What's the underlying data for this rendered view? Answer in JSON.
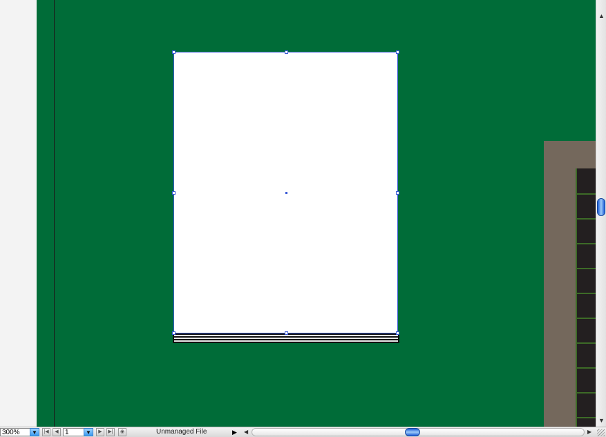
{
  "document": {
    "zoom": "300%",
    "page_number": "1",
    "status": "Unmanaged File"
  },
  "icons": {
    "zoom_dropdown": "chevron-down-icon",
    "first_page": "first-page-icon",
    "prev_page": "prev-page-icon",
    "page_dropdown": "chevron-down-icon",
    "next_page": "next-page-icon",
    "last_page": "last-page-icon",
    "preflight": "preflight-icon",
    "status_menu": "triangle-right-icon",
    "scroll_left": "arrow-left-icon",
    "scroll_right": "arrow-right-icon",
    "scroll_up": "arrow-up-icon",
    "scroll_down": "arrow-down-icon"
  },
  "colors": {
    "pasteboard": "#006c38",
    "selection": "#3a5ad6",
    "scroll_thumb": "#1c5cd8"
  }
}
